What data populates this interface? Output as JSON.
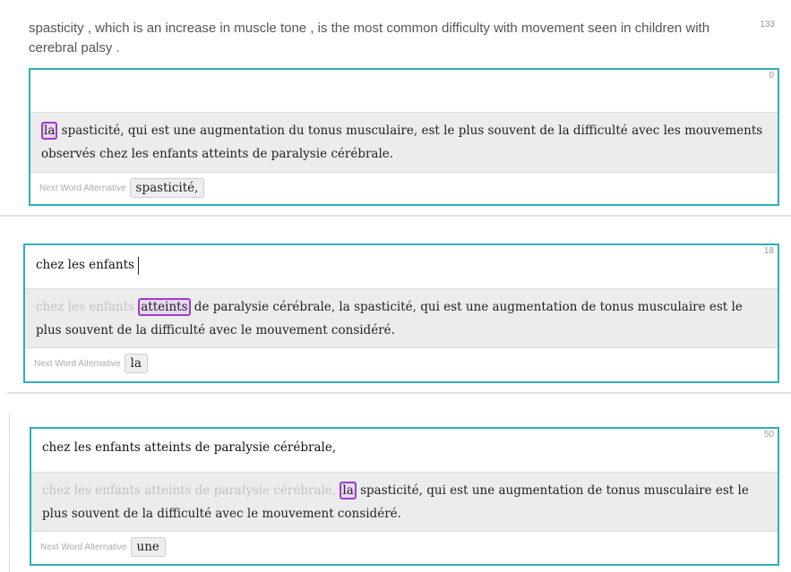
{
  "source": {
    "text": "spasticity , which is an increase in muscle tone , is the most common difficulty with movement seen in children with cerebral palsy .",
    "char_count": "133"
  },
  "panels": [
    {
      "count": "0",
      "input": "",
      "prefix": "",
      "highlight": "la",
      "rest": " spasticité, qui est une augmentation du tonus musculaire, est le plus souvent de la difficulté avec les mouvements observés chez les enfants atteints de paralysie cérébrale.",
      "alt_label": "Next Word Alternative",
      "alt_word": "spasticité,"
    },
    {
      "count": "18",
      "input": "chez les enfants",
      "prefix": "chez les enfants ",
      "highlight": "atteints",
      "rest": " de paralysie cérébrale, la spasticité, qui est une augmentation de tonus musculaire est le plus souvent de la difficulté avec le mouvement considéré.",
      "alt_label": "Next Word Alternative",
      "alt_word": "la"
    },
    {
      "count": "50",
      "input": "chez les enfants atteints de paralysie cérébrale,",
      "prefix": "chez les enfants atteints de paralysie cérébrale, ",
      "highlight": "la",
      "rest": " spasticité, qui est une augmentation de tonus musculaire est le plus souvent de la difficulté avec le mouvement considéré.",
      "alt_label": "Next Word Alternative",
      "alt_word": "une"
    }
  ],
  "colors": {
    "panel_border": "#2eb0b8",
    "highlight_border": "#9b3fc7",
    "suggestion_bg": "#ececec"
  }
}
